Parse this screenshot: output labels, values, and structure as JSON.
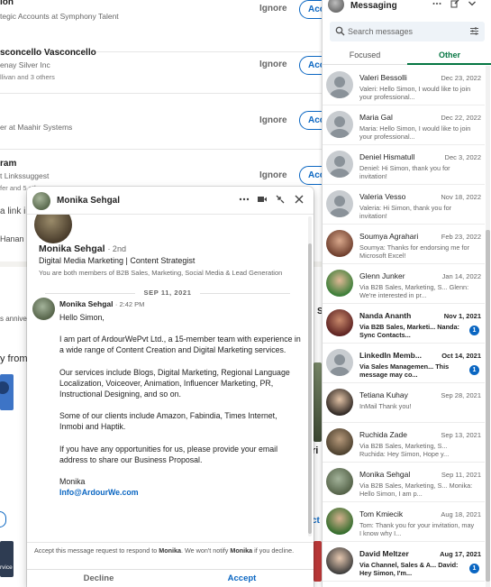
{
  "invitations": [
    {
      "name": "lon",
      "sub": "tegic Accounts at Symphony Talent",
      "sub2": "",
      "ignore": "Ignore",
      "accept": "Acc"
    },
    {
      "name": "sconcello Vasconcello",
      "sub": "enay Silver Inc",
      "sub2": "llivan and 3 others",
      "ignore": "Ignore",
      "accept": "Acc"
    },
    {
      "name": "",
      "sub": "er at Maahir Systems",
      "sub2": "",
      "ignore": "Ignore",
      "accept": "Acc"
    },
    {
      "name": "ram",
      "sub": "t Linkssuggest",
      "sub2": "fer and 5 other",
      "ignore": "Ignore",
      "accept": "Acc"
    }
  ],
  "background": {
    "link_fragment": "a link i",
    "name_fragment": "Hanan",
    "anniv_fragment": "s anniver",
    "view_from": "y from",
    "s_fragment": "S",
    "ri_fragment": "ri",
    "ct_fragment": "ct",
    "service_fragment": "rvice"
  },
  "chat": {
    "title": "Monika Sehgal",
    "header_icons": [
      "more-icon",
      "video-icon",
      "minimize-icon",
      "close-icon"
    ],
    "profile": {
      "name": "Monika Sehgal",
      "degree": "· 2nd",
      "headline": "Digital Media Marketing | Content Strategist",
      "mutual": "You are both members of B2B Sales, Marketing, Social Media & Lead Generation"
    },
    "date_separator": "SEP 11, 2021",
    "message": {
      "sender": "Monika Sehgal",
      "time": "· 2:42 PM",
      "greeting": "Hello Simon,",
      "p1": "I am part of ArdourWePvt Ltd., a 15-member team with experience in a wide range of Content Creation and Digital Marketing services.",
      "p2": "Our services include Blogs, Digital Marketing, Regional Language Localization, Voiceover, Animation, Influencer Marketing, PR, Instructional Designing, and so on.",
      "p3": "Some of our clients include Amazon, Fabindia, Times Internet, Inmobi and Haptik.",
      "p4": "If you have any opportunities for us, please provide your email address to share our Business Proposal.",
      "signature": "Monika",
      "email": "Info@ArdourWe.com"
    },
    "footer": {
      "note_prefix": "Accept this message request to respond to ",
      "note_name": "Monika",
      "note_middle": ". We won't notify ",
      "note_name2": "Monika",
      "note_suffix": " if you decline.",
      "decline": "Decline",
      "accept": "Accept"
    }
  },
  "messaging": {
    "title": "Messaging",
    "search_placeholder": "Search messages",
    "tabs": {
      "focused": "Focused",
      "other": "Other"
    },
    "conversations": [
      {
        "name": "Valeri Bessolli",
        "date": "Dec 23, 2022",
        "preview": "Valeri: Hello Simon, I would like to join your professional...",
        "unread": false
      },
      {
        "name": "Maria Gal",
        "date": "Dec 22, 2022",
        "preview": "Maria: Hello Simon, I would like to join your professional...",
        "unread": false
      },
      {
        "name": "Deniel Hismatull",
        "date": "Dec 3, 2022",
        "preview": "Deniel: Hi Simon, thank you for invitation!",
        "unread": false
      },
      {
        "name": "Valeria Vesso",
        "date": "Nov 18, 2022",
        "preview": "Valeria: Hi Simon, thank you for invitation!",
        "unread": false
      },
      {
        "name": "Soumya Agrahari",
        "date": "Feb 23, 2022",
        "preview": "Soumya: Thanks for endorsing me for Microsoft Excel!",
        "unread": false
      },
      {
        "name": "Glenn Junker",
        "date": "Jan 14, 2022",
        "preview": "Via B2B Sales, Marketing, S... Glenn: We're interested in pr...",
        "unread": false
      },
      {
        "name": "Nanda Ananth",
        "date": "Nov 1, 2021",
        "preview": "Via B2B Sales, Marketi... Nanda: Sync Contacts...",
        "unread": true,
        "badge": "1"
      },
      {
        "name": "LinkedIn Memb...",
        "date": "Oct 14, 2021",
        "preview": "Via Sales Managemen... This message may co...",
        "unread": true,
        "badge": "1"
      },
      {
        "name": "Tetiana Kuhay",
        "date": "Sep 28, 2021",
        "preview": "InMail  Thank you!",
        "unread": false
      },
      {
        "name": "Ruchida Zade",
        "date": "Sep 13, 2021",
        "preview": "Via B2B Sales, Marketing, S... Ruchida: Hey Simon, Hope y...",
        "unread": false
      },
      {
        "name": "Monika Sehgal",
        "date": "Sep 11, 2021",
        "preview": "Via B2B Sales, Marketing, S... Monika: Hello Simon, I am p...",
        "unread": false
      },
      {
        "name": "Tom Kmiecik",
        "date": "Aug 18, 2021",
        "preview": "Tom: Thank you for your invitation, may I know why I...",
        "unread": false
      },
      {
        "name": "David Meltzer",
        "date": "Aug 17, 2021",
        "preview": "Via Channel, Sales & A... David: Hey Simon, I'm...",
        "unread": true,
        "badge": "1"
      }
    ]
  },
  "colors": {
    "brand_blue": "#0a66c2",
    "tab_green": "#057642"
  }
}
